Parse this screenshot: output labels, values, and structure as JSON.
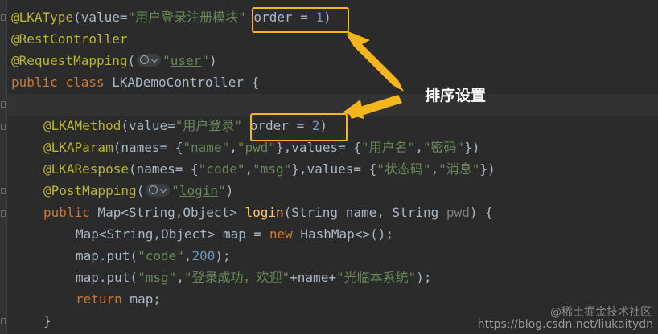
{
  "code": {
    "l1": {
      "ann": "@LKAType",
      "p1": "(",
      "key": "value=",
      "val": "\"用户登录注册模块\"",
      "sep": " ",
      "order": "order = ",
      "num": "1",
      "close": ")"
    },
    "l2": {
      "ann": "@RestController"
    },
    "l3": {
      "ann": "@RequestMapping",
      "p1": "(",
      "val": "\"user\"",
      "p2": "\"",
      "close": ")"
    },
    "l4": {
      "kw1": "public",
      "kw2": "class",
      "name": "LKADemoController {"
    },
    "l6": {
      "ann": "@LKAMethod",
      "p1": "(",
      "key": "value=",
      "val": "\"用户登录\"",
      "order": "order = ",
      "num": "2",
      "close": ")"
    },
    "l7": {
      "ann": "@LKAParam",
      "rest_a": "(names= {",
      "s1": "\"name\"",
      "c1": ",",
      "s2": "\"pwd\"",
      "rest_b": "},values= {",
      "s3": "\"用户名\"",
      "c2": ",",
      "s4": "\"密码\"",
      "rest_c": "})"
    },
    "l8": {
      "ann": "@LKARespose",
      "rest_a": "(names= {",
      "s1": "\"code\"",
      "c1": ",",
      "s2": "\"msg\"",
      "rest_b": "},values= {",
      "s3": "\"状态码\"",
      "c2": ",",
      "s4": "\"消息\"",
      "rest_c": "})"
    },
    "l9": {
      "ann": "@PostMapping",
      "p1": "(",
      "val": "login",
      "close": ")"
    },
    "l10": {
      "kw": "public",
      "a": " Map<String,Object> ",
      "fn": "login",
      "b": "(String name, String ",
      "param": "pwd",
      "c": ") {"
    },
    "l11": {
      "a": "Map<String,Object> map = ",
      "kw": "new",
      "b": " HashMap<>();"
    },
    "l12": {
      "a": "map.put(",
      "s": "\"code\"",
      "b": ",",
      "n": "200",
      "c": ");"
    },
    "l13": {
      "a": "map.put(",
      "s1": "\"msg\"",
      "b": ",",
      "s2": "\"登录成功，欢迎\"",
      "c": "+name+",
      "s3": "\"光临本系统\"",
      "d": ");"
    },
    "l14": {
      "kw": "return",
      "a": " map;"
    },
    "l15": {
      "a": "}"
    }
  },
  "annotation_label": "排序设置",
  "watermark_top": "@稀土掘金技术社区",
  "watermark_bottom": "https://blog.csdn.net/liukaitydn",
  "colors": {
    "accent": "#f5b51d",
    "background": "#2b2b2b",
    "annotation": "#bbb529",
    "keyword": "#cc7832",
    "string": "#6a8759",
    "number": "#6897bb"
  }
}
